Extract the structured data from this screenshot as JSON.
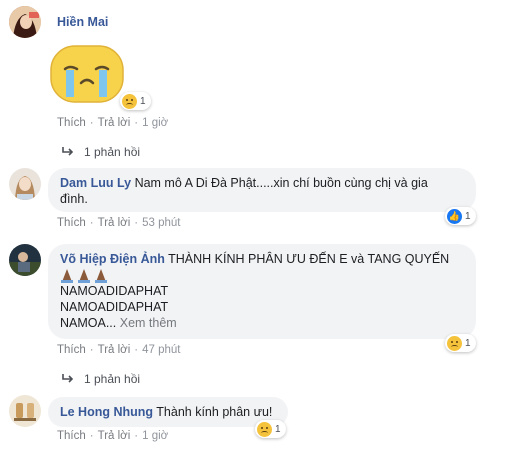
{
  "comments": [
    {
      "author": "Hiền Mai",
      "actions": {
        "like": "Thích",
        "reply": "Trả lời",
        "time": "1 giờ"
      },
      "reaction_count": "1",
      "replies": "1 phản hồi"
    },
    {
      "author": "Dam Luu Ly",
      "text_line1": "Nam mô A Di Đà Phật.....xin chí buồn cùng chị và gia",
      "text_line2": "đình.",
      "actions": {
        "like": "Thích",
        "reply": "Trả lời",
        "time": "53 phút"
      },
      "reaction_count": "1"
    },
    {
      "author": "Võ Hiệp Điện Ảnh",
      "text_line1": "THÀNH KÍNH PHÂN ƯU ĐẾN E và TANG QUYẾN",
      "lines": [
        "NAMOADIDAPHAT",
        "NAMOADIDAPHAT"
      ],
      "line_last": "NAMOA...",
      "see_more": "Xem thêm",
      "actions": {
        "like": "Thích",
        "reply": "Trả lời",
        "time": "47 phút"
      },
      "reaction_count": "1",
      "replies": "1 phản hồi"
    },
    {
      "author": "Le Hong Nhung",
      "text": "Thành kính phân ưu!",
      "actions": {
        "like": "Thích",
        "reply": "Trả lời",
        "time": "1 giờ"
      },
      "reaction_count": "1"
    }
  ],
  "icons": {
    "sticker": "crying-face-sticker",
    "sad": "sad-reaction-icon",
    "like": "like-reaction-icon",
    "reply_arrow": "reply-arrow-icon",
    "praying_hands": "praying-hands-icon"
  },
  "colors": {
    "name": "#385898",
    "bubble": "#f2f3f5",
    "meta": "#90949c"
  }
}
